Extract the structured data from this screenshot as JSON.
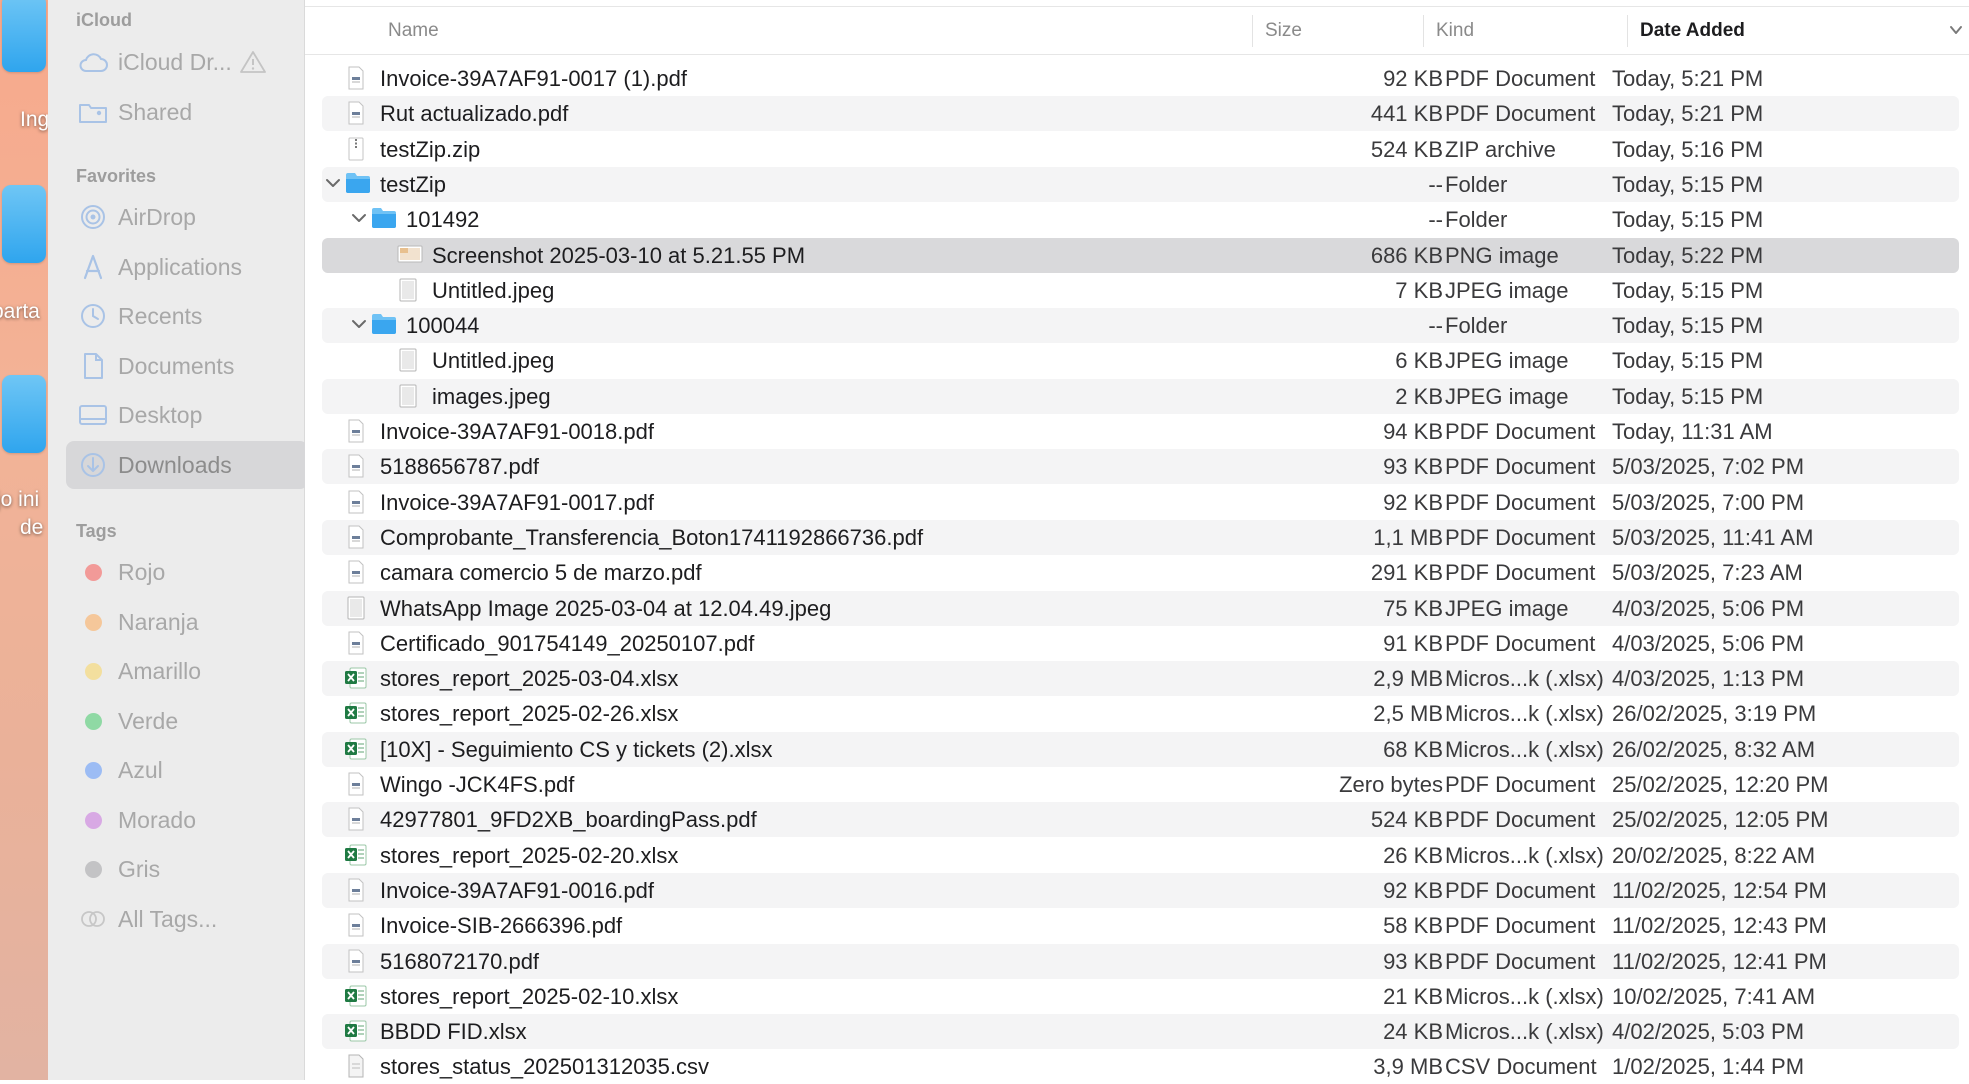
{
  "desktop": {
    "labels": [
      "Ing",
      "parta",
      "jo ini",
      "de"
    ]
  },
  "sidebar": {
    "icloud_header": "iCloud",
    "icloud_items": [
      {
        "label": "iCloud Dr...",
        "icon": "cloud-icon"
      },
      {
        "label": "Shared",
        "icon": "shared-folder-icon"
      }
    ],
    "favorites_header": "Favorites",
    "favorites": [
      {
        "label": "AirDrop",
        "icon": "airdrop-icon"
      },
      {
        "label": "Applications",
        "icon": "applications-icon"
      },
      {
        "label": "Recents",
        "icon": "clock-icon"
      },
      {
        "label": "Documents",
        "icon": "document-icon"
      },
      {
        "label": "Desktop",
        "icon": "desktop-icon"
      },
      {
        "label": "Downloads",
        "icon": "download-icon",
        "active": true
      }
    ],
    "tags_header": "Tags",
    "tags": [
      {
        "label": "Rojo",
        "color": "#f29a98"
      },
      {
        "label": "Naranja",
        "color": "#f5c79a"
      },
      {
        "label": "Amarillo",
        "color": "#f3df9e"
      },
      {
        "label": "Verde",
        "color": "#8fd9a4"
      },
      {
        "label": "Azul",
        "color": "#9cbcf4"
      },
      {
        "label": "Morado",
        "color": "#d8a9e4"
      },
      {
        "label": "Gris",
        "color": "#c3c3c5"
      },
      {
        "label": "All Tags...",
        "color": ""
      }
    ]
  },
  "columns": {
    "name": "Name",
    "size": "Size",
    "kind": "Kind",
    "date_added": "Date Added"
  },
  "files": [
    {
      "name": "Invoice-39A7AF91-0017 (1).pdf",
      "size": "92 KB",
      "kind": "PDF Document",
      "date": "Today, 5:21 PM",
      "icon": "pdf",
      "level": 0
    },
    {
      "name": "Rut actualizado.pdf",
      "size": "441 KB",
      "kind": "PDF Document",
      "date": "Today, 5:21 PM",
      "icon": "pdf",
      "level": 0
    },
    {
      "name": "testZip.zip",
      "size": "524 KB",
      "kind": "ZIP archive",
      "date": "Today, 5:16 PM",
      "icon": "zip",
      "level": 0
    },
    {
      "name": "testZip",
      "size": "--",
      "kind": "Folder",
      "date": "Today, 5:15 PM",
      "icon": "folder",
      "level": 0,
      "expanded": true
    },
    {
      "name": "101492",
      "size": "--",
      "kind": "Folder",
      "date": "Today, 5:15 PM",
      "icon": "folder",
      "level": 1,
      "expanded": true
    },
    {
      "name": "Screenshot 2025-03-10 at 5.21.55 PM",
      "size": "686 KB",
      "kind": "PNG image",
      "date": "Today, 5:22 PM",
      "icon": "png",
      "level": 2,
      "selected": true
    },
    {
      "name": "Untitled.jpeg",
      "size": "7 KB",
      "kind": "JPEG image",
      "date": "Today, 5:15 PM",
      "icon": "jpeg",
      "level": 2
    },
    {
      "name": "100044",
      "size": "--",
      "kind": "Folder",
      "date": "Today, 5:15 PM",
      "icon": "folder",
      "level": 1,
      "expanded": true
    },
    {
      "name": "Untitled.jpeg",
      "size": "6 KB",
      "kind": "JPEG image",
      "date": "Today, 5:15 PM",
      "icon": "jpeg",
      "level": 2
    },
    {
      "name": "images.jpeg",
      "size": "2 KB",
      "kind": "JPEG image",
      "date": "Today, 5:15 PM",
      "icon": "jpeg",
      "level": 2
    },
    {
      "name": "Invoice-39A7AF91-0018.pdf",
      "size": "94 KB",
      "kind": "PDF Document",
      "date": "Today, 11:31 AM",
      "icon": "pdf",
      "level": 0
    },
    {
      "name": "5188656787.pdf",
      "size": "93 KB",
      "kind": "PDF Document",
      "date": "5/03/2025, 7:02 PM",
      "icon": "pdf",
      "level": 0
    },
    {
      "name": "Invoice-39A7AF91-0017.pdf",
      "size": "92 KB",
      "kind": "PDF Document",
      "date": "5/03/2025, 7:00 PM",
      "icon": "pdf",
      "level": 0
    },
    {
      "name": "Comprobante_Transferencia_Boton1741192866736.pdf",
      "size": "1,1 MB",
      "kind": "PDF Document",
      "date": "5/03/2025, 11:41 AM",
      "icon": "pdf",
      "level": 0
    },
    {
      "name": "camara comercio 5 de marzo.pdf",
      "size": "291 KB",
      "kind": "PDF Document",
      "date": "5/03/2025, 7:23 AM",
      "icon": "pdf",
      "level": 0
    },
    {
      "name": "WhatsApp Image 2025-03-04 at 12.04.49.jpeg",
      "size": "75 KB",
      "kind": "JPEG image",
      "date": "4/03/2025, 5:06 PM",
      "icon": "jpeg",
      "level": 0
    },
    {
      "name": "Certificado_901754149_20250107.pdf",
      "size": "91 KB",
      "kind": "PDF Document",
      "date": "4/03/2025, 5:06 PM",
      "icon": "pdf",
      "level": 0
    },
    {
      "name": "stores_report_2025-03-04.xlsx",
      "size": "2,9 MB",
      "kind": "Micros...k (.xlsx)",
      "date": "4/03/2025, 1:13 PM",
      "icon": "xlsx",
      "level": 0
    },
    {
      "name": "stores_report_2025-02-26.xlsx",
      "size": "2,5 MB",
      "kind": "Micros...k (.xlsx)",
      "date": "26/02/2025, 3:19 PM",
      "icon": "xlsx",
      "level": 0
    },
    {
      "name": "[10X] - Seguimiento CS y tickets  (2).xlsx",
      "size": "68 KB",
      "kind": "Micros...k (.xlsx)",
      "date": "26/02/2025, 8:32 AM",
      "icon": "xlsx",
      "level": 0
    },
    {
      "name": "Wingo -JCK4FS.pdf",
      "size": "Zero bytes",
      "kind": "PDF Document",
      "date": "25/02/2025, 12:20 PM",
      "icon": "pdf",
      "level": 0
    },
    {
      "name": "42977801_9FD2XB_boardingPass.pdf",
      "size": "524 KB",
      "kind": "PDF Document",
      "date": "25/02/2025, 12:05 PM",
      "icon": "pdf",
      "level": 0
    },
    {
      "name": "stores_report_2025-02-20.xlsx",
      "size": "26 KB",
      "kind": "Micros...k (.xlsx)",
      "date": "20/02/2025, 8:22 AM",
      "icon": "xlsx",
      "level": 0
    },
    {
      "name": "Invoice-39A7AF91-0016.pdf",
      "size": "92 KB",
      "kind": "PDF Document",
      "date": "11/02/2025, 12:54 PM",
      "icon": "pdf",
      "level": 0
    },
    {
      "name": "Invoice-SIB-2666396.pdf",
      "size": "58 KB",
      "kind": "PDF Document",
      "date": "11/02/2025, 12:43 PM",
      "icon": "pdf",
      "level": 0
    },
    {
      "name": "5168072170.pdf",
      "size": "93 KB",
      "kind": "PDF Document",
      "date": "11/02/2025, 12:41 PM",
      "icon": "pdf",
      "level": 0
    },
    {
      "name": "stores_report_2025-02-10.xlsx",
      "size": "21 KB",
      "kind": "Micros...k (.xlsx)",
      "date": "10/02/2025, 7:41 AM",
      "icon": "xlsx",
      "level": 0
    },
    {
      "name": "BBDD FID.xlsx",
      "size": "24 KB",
      "kind": "Micros...k (.xlsx)",
      "date": "4/02/2025, 5:03 PM",
      "icon": "xlsx",
      "level": 0
    },
    {
      "name": "stores_status_202501312035.csv",
      "size": "3,9 MB",
      "kind": "CSV Document",
      "date": "1/02/2025, 1:44 PM",
      "icon": "csv",
      "level": 0
    }
  ]
}
